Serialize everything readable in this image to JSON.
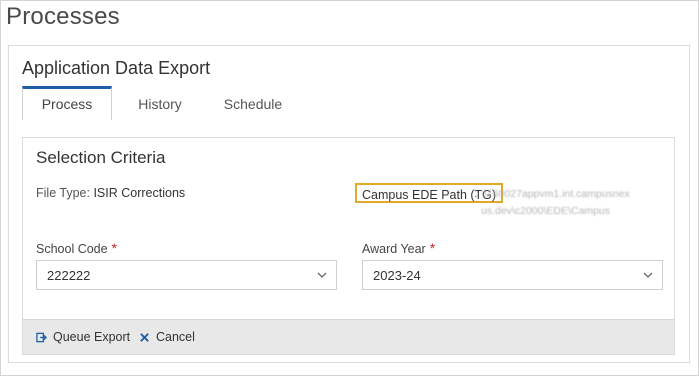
{
  "page": {
    "title": "Processes"
  },
  "card": {
    "title": "Application Data Export",
    "tabs": [
      {
        "label": "Process",
        "active": true
      },
      {
        "label": "History",
        "active": false
      },
      {
        "label": "Schedule",
        "active": false
      }
    ]
  },
  "criteria": {
    "title": "Selection Criteria",
    "file_type_label": "File Type:",
    "file_type_value": "ISIR Corrections",
    "path_label": "Campus EDE Path (TG)",
    "path_separator": ":",
    "path_value_line1": "\\\\160027appvm1.int.campusnex",
    "path_value_line2": "us.dev\\c2000\\EDE\\Campus",
    "school_code_label": "School Code",
    "school_code_value": "222222",
    "award_year_label": "Award Year",
    "award_year_value": "2023-24",
    "required_mark": "*"
  },
  "footer": {
    "queue_label": "Queue Export",
    "cancel_label": "Cancel"
  },
  "colors": {
    "accent": "#1f5fa8",
    "highlight": "#e0a92a",
    "required": "#c62828",
    "footer_bg": "#e8e8e8"
  }
}
